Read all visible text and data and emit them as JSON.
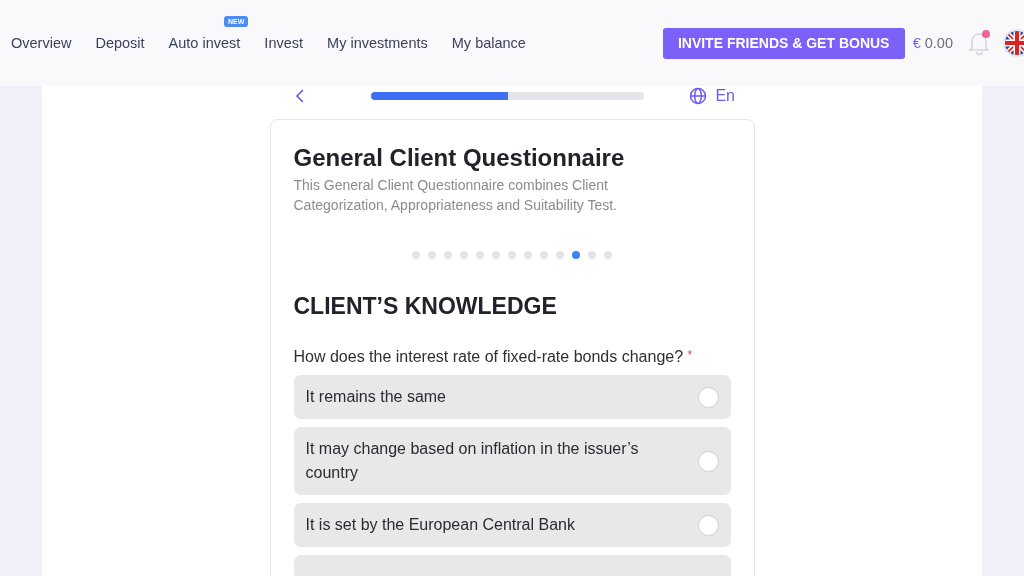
{
  "nav": [
    {
      "label": "Overview"
    },
    {
      "label": "Deposit"
    },
    {
      "label": "Auto invest",
      "badge": "NEW"
    },
    {
      "label": "Invest"
    },
    {
      "label": "My investments"
    },
    {
      "label": "My balance"
    }
  ],
  "invite_button": "INVITE FRIENDS & GET BONUS",
  "balance": {
    "currency": "€",
    "amount": "0.00"
  },
  "notifications": {
    "unread": true
  },
  "progress": {
    "level": 0.5
  },
  "language": "En",
  "card": {
    "title": "General Client Questionnaire",
    "description": "This General Client Questionnaire combines Client Categorization, Appropriateness and Suitability Test.",
    "steps": [
      {
        "selected": false
      },
      {
        "selected": false
      },
      {
        "selected": false
      },
      {
        "selected": false
      },
      {
        "selected": false
      },
      {
        "selected": false
      },
      {
        "selected": false
      },
      {
        "selected": false
      },
      {
        "selected": false
      },
      {
        "selected": false
      },
      {
        "selected": true
      },
      {
        "selected": false
      },
      {
        "selected": false
      }
    ],
    "section": "CLIENT’S KNOWLEDGE",
    "question": {
      "text": "How does the interest rate of fixed-rate bonds change?",
      "required_mark": "*"
    },
    "options": [
      {
        "label": "It remains the same",
        "selected": false
      },
      {
        "label": "It may change based on inflation in the issuer’s country",
        "selected": false
      },
      {
        "label": "It is set by the European Central Bank",
        "selected": false
      }
    ]
  }
}
